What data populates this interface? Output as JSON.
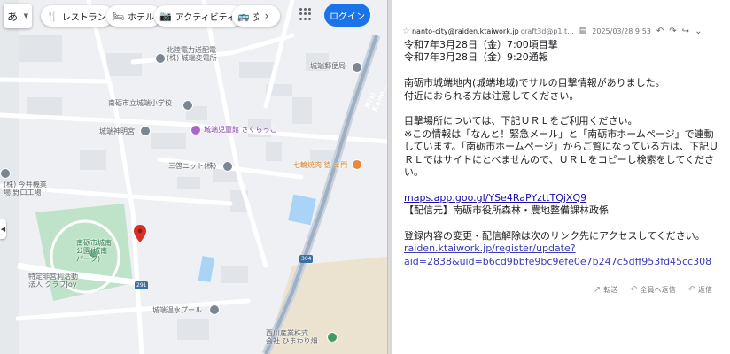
{
  "map": {
    "ime_label": "あ",
    "chips": [
      {
        "icon": "restaurant-icon",
        "glyph": "🍴",
        "label": "レストラン"
      },
      {
        "icon": "hotel-icon",
        "glyph": "🛏",
        "label": "ホテル"
      },
      {
        "icon": "camera-icon",
        "glyph": "📷",
        "label": "アクティビティ"
      },
      {
        "icon": "transit-icon",
        "glyph": "🚌",
        "label": "交"
      }
    ],
    "login_label": "ログイン",
    "labels": {
      "hokuriku_denryoku": "北陸電力送配電\n(株) 城端変電所",
      "jouhana_post": "城端郵便局",
      "elementary": "南砺市立城端小学校",
      "jidoukan": "城端児童館 さくらっこ",
      "shinmeigu": "城端神明宮",
      "mitsubishi": "三啓ニット(株)",
      "shichirin": "七輪焼肉 徳 ェ門",
      "imai": "(株) 今井機業\n場 野口工場",
      "park": "南砺市城南\n公園(城南\nパーク)",
      "npo": "特定非営利活動\n法人 クラブJoy",
      "pool": "城端温水プール",
      "nishikawa": "西川産業株式\n会社 ひまわり畑",
      "route_304": "304",
      "route_291": "291",
      "road_name": "Nisi Kano..."
    },
    "colors": {
      "brand": "#1a73e8",
      "pin": "#d93025",
      "park": "#bfe3c8",
      "water": "#a9d4f5"
    }
  },
  "mail": {
    "from": "nanto-city@raiden.ktaiwork.jp",
    "to": "craft3d@p1.t...",
    "date": "2025/03/28 9:53",
    "body": {
      "line1": "令和7年3月28日（金）7:00頃目撃",
      "line2": "令和7年3月28日（金）9:20通報",
      "para1a": "南砺市城端地内(城端地域)でサルの目撃情報がありました。",
      "para1b": "付近におられる方は注意してください。",
      "para2a": "目撃場所については、下記ＵＲＬをご利用ください。",
      "para2b": "※この情報は「なんと！緊急メール」と「南砺市ホームページ」で連動しています。「南砺市ホームページ」からご覧になっている方は、下記ＵＲＬではサイトにとべませんので、ＵＲＬをコピーし検索をしてください。",
      "map_link": "maps.app.goo.gl/YSe4RaPYzttTQjXQ9",
      "source": "【配信元】南砺市役所森林・農地整備課林政係",
      "para3": "登録内容の変更・配信解除は次のリンク先にアクセスしてください。",
      "register_link_a": "raiden.ktaiwork.jp/register/update?",
      "register_link_b": "aid=2838&uid=b6cd9bbfe9bc9efe0e7b247c5dff953fd45cc308"
    },
    "footer": {
      "forward": "転送",
      "reply_all": "全員へ返信",
      "reply": "返信"
    }
  }
}
